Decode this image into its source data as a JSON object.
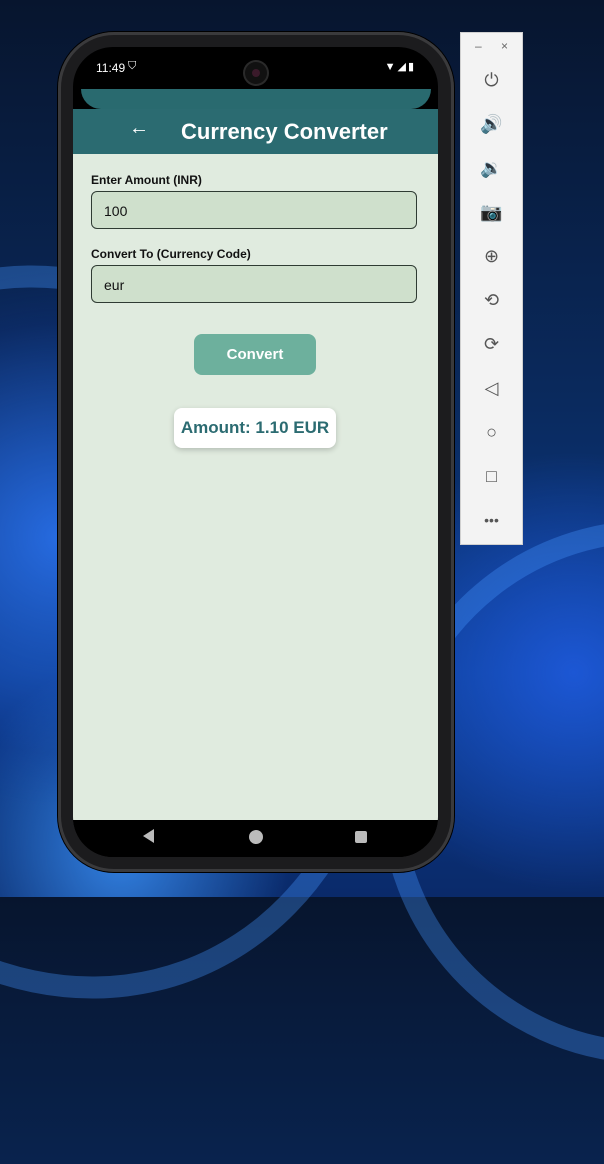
{
  "status_bar": {
    "time": "11:49",
    "shield_icon": "shield",
    "right_icons": "▼◢▮"
  },
  "app_bar": {
    "back_icon": "←",
    "title": "Currency Converter"
  },
  "form": {
    "amount_label": "Enter Amount (INR)",
    "amount_value": "100",
    "code_label": "Convert To (Currency Code)",
    "code_value": "eur",
    "convert_label": "Convert"
  },
  "result": {
    "text": "Amount: 1.10 EUR"
  },
  "emulator_toolbar": {
    "minimize": "–",
    "close": "×",
    "buttons": [
      {
        "icon": "power-icon",
        "glyph": "⏻"
      },
      {
        "icon": "volume-up-icon",
        "glyph": "🔊"
      },
      {
        "icon": "volume-down-icon",
        "glyph": "🔉"
      },
      {
        "icon": "camera-icon",
        "glyph": "📷"
      },
      {
        "icon": "zoom-icon",
        "glyph": "⊕"
      },
      {
        "icon": "rotate-left-icon",
        "glyph": "⟲"
      },
      {
        "icon": "rotate-right-icon",
        "glyph": "⟳"
      },
      {
        "icon": "back-icon",
        "glyph": "◁"
      },
      {
        "icon": "home-icon",
        "glyph": "○"
      },
      {
        "icon": "overview-icon",
        "glyph": "□"
      },
      {
        "icon": "more-icon",
        "glyph": "•••"
      }
    ]
  },
  "colors": {
    "app_bar": "#2b6b71",
    "content_bg": "#e0ebdf",
    "field_bg": "#cfe0cc",
    "button": "#6db09d",
    "result_text": "#2b6b71"
  }
}
